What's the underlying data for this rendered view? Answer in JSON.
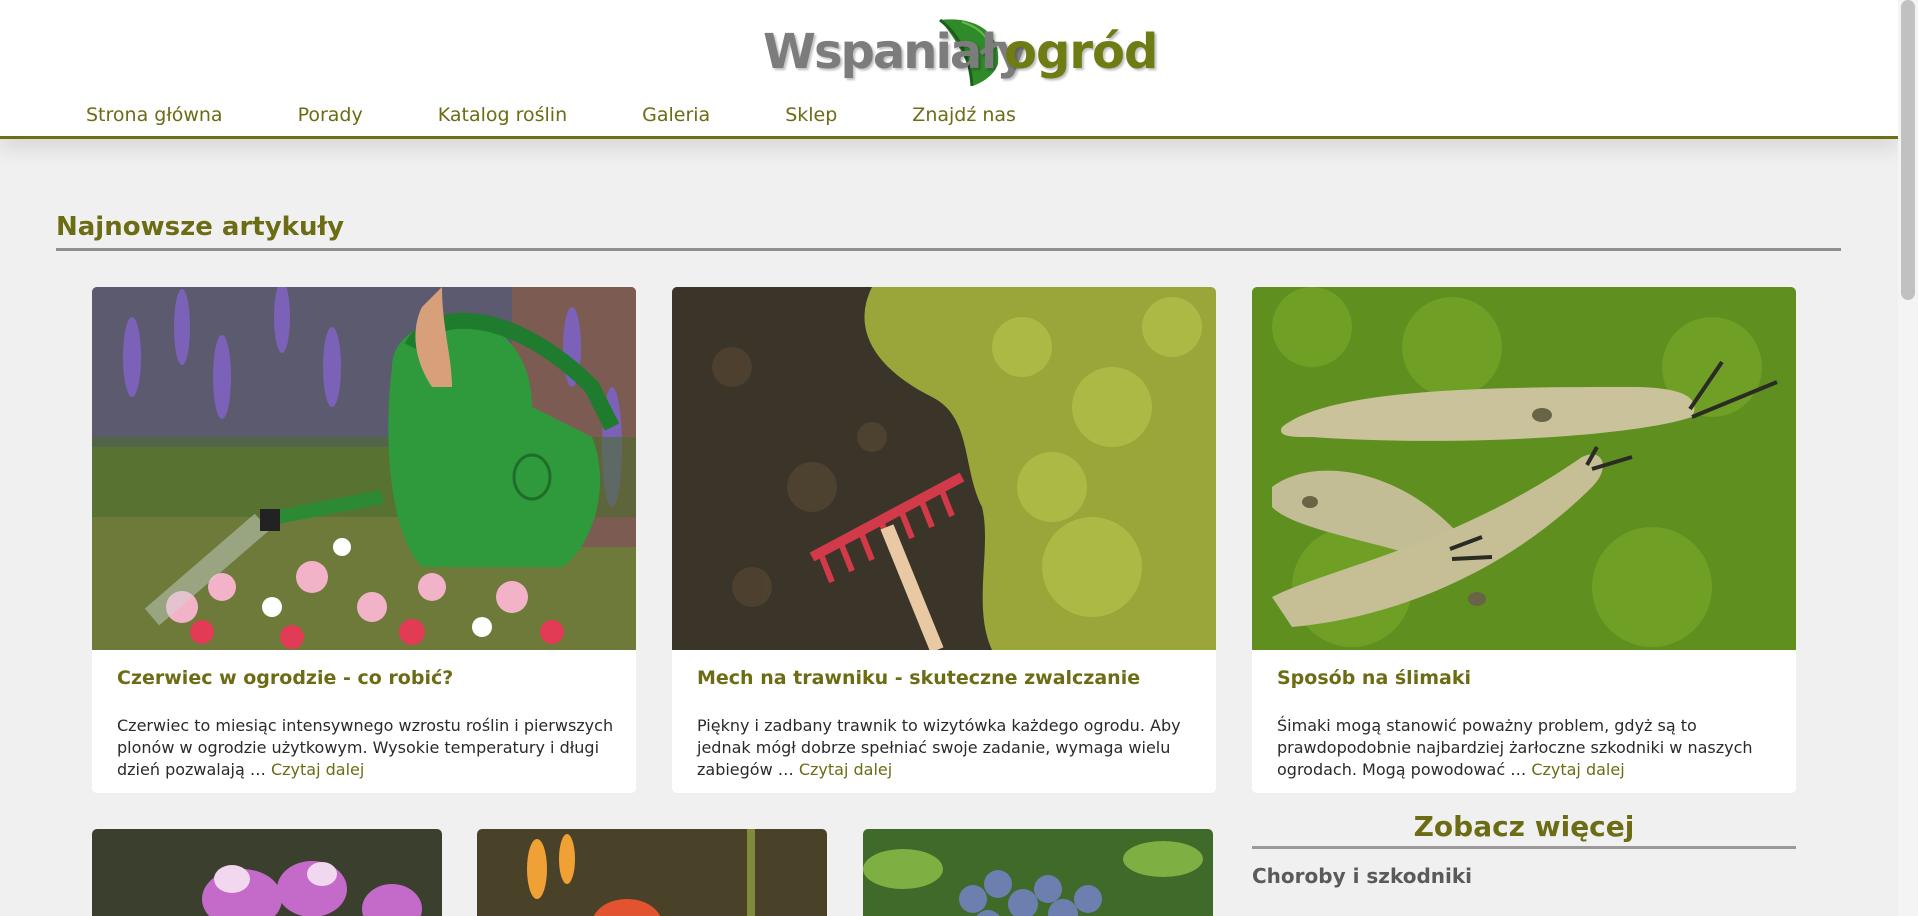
{
  "site": {
    "logo_part1": "Wspaniały",
    "logo_part2": "ogród"
  },
  "nav": {
    "items": [
      {
        "label": "Strona główna"
      },
      {
        "label": "Porady"
      },
      {
        "label": "Katalog roślin"
      },
      {
        "label": "Galeria"
      },
      {
        "label": "Sklep"
      },
      {
        "label": "Znajdź nas"
      }
    ]
  },
  "section": {
    "title": "Najnowsze artykuły"
  },
  "articles": [
    {
      "title": "Czerwiec w ogrodzie - co robić?",
      "excerpt": "Czerwiec to miesiąc intensywnego wzrostu roślin i pierwszych plonów w ogrodzie użytkowym. Wysokie temperatury i długi dzień pozwalają …",
      "read_more": "Czytaj dalej"
    },
    {
      "title": "Mech na trawniku - skuteczne zwalczanie",
      "excerpt": "Piękny i zadbany trawnik to wizytówka każdego ogrodu. Aby jednak mógł dobrze spełniać swoje zadanie, wymaga wielu zabiegów …",
      "read_more": "Czytaj dalej"
    },
    {
      "title": "Sposób na ślimaki",
      "excerpt": "Śimaki mogą stanowić poważny problem, gdyż są to prawdopodobnie najbardziej żarłoczne szkodniki w naszych ogrodach. Mogą powodować …",
      "read_more": "Czytaj dalej"
    }
  ],
  "sidebar": {
    "see_more": "Zobacz więcej",
    "category": "Choroby i szkodniki"
  },
  "colors": {
    "accent": "#6c6c15",
    "logo_gray": "#7c7c7c",
    "logo_green": "#6f7b13",
    "background": "#f0f0f0"
  }
}
